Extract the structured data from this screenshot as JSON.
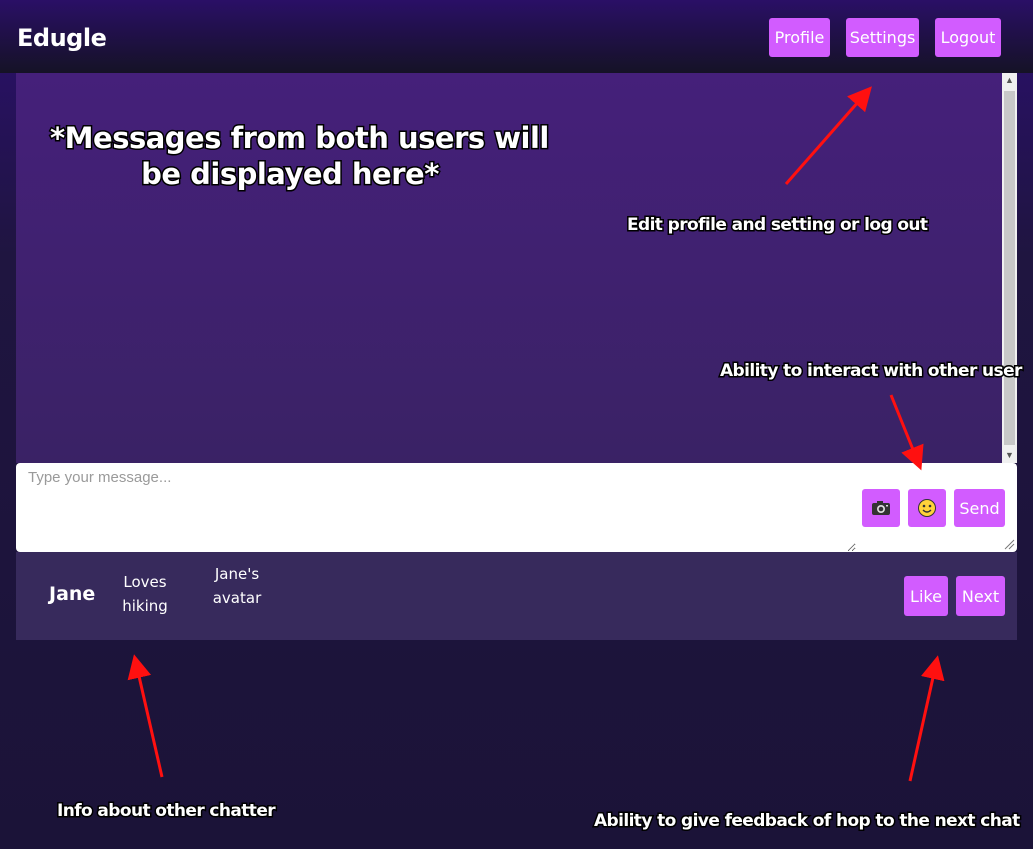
{
  "app": {
    "brand": "Edugle"
  },
  "nav": {
    "profile": "Profile",
    "settings": "Settings",
    "logout": "Logout"
  },
  "composer": {
    "placeholder": "Type your message...",
    "camera_icon": "camera-icon",
    "emoji_icon": "emoji-icon",
    "send": "Send"
  },
  "chatter": {
    "name": "Jane",
    "bio_line1": "Loves",
    "bio_line2": "hiking",
    "avatar_line1": "Jane's",
    "avatar_line2": "avatar"
  },
  "actions": {
    "like": "Like",
    "next": "Next"
  },
  "annotations": {
    "messages_line1": "*Messages from both users will",
    "messages_line2": "be displayed here*",
    "edit": "Edit profile and setting or log out",
    "interact": "Ability to interact with other user",
    "info": "Info about other chatter",
    "feedback": "Ability to give feedback of hop to the next chat"
  },
  "colors": {
    "accent": "#d25cff",
    "arrow": "#ff1010"
  }
}
